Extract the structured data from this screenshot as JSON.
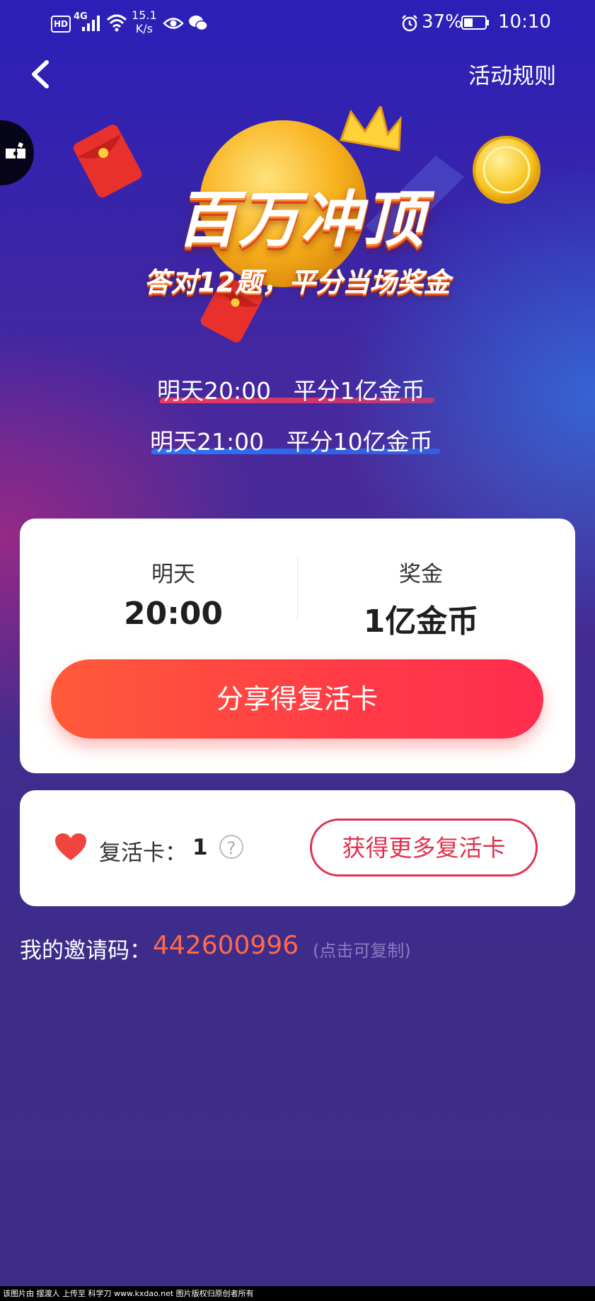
{
  "status_bar": {
    "hd": "HD",
    "network": "4G",
    "speed_value": "15.1",
    "speed_unit": "K/s",
    "battery": "37%",
    "time": "10:10"
  },
  "header": {
    "rules_label": "活动规则"
  },
  "hero": {
    "title": "百万冲顶",
    "subtitle": "答对12题，平分当场奖金"
  },
  "schedule": [
    {
      "time": "明天20:00",
      "prize": "平分1亿金币"
    },
    {
      "time": "明天21:00",
      "prize": "平分10亿金币"
    }
  ],
  "next_game": {
    "day_label": "明天",
    "time": "20:00",
    "prize_label": "奖金",
    "prize_value": "1亿金币",
    "share_button": "分享得复活卡"
  },
  "revive": {
    "label": "复活卡：",
    "count": "1",
    "help_symbol": "?",
    "more_button": "获得更多复活卡"
  },
  "invite": {
    "label": "我的邀请码：",
    "code": "442600996",
    "hint": "(点击可复制)"
  },
  "footer": {
    "text": "该图片由 摆渡人 上传至 科学刀 www.kxdao.net 图片版权归原创者所有"
  },
  "colors": {
    "accent": "#ff3b46",
    "invite_code": "#ff6b4a",
    "outline_button": "#e0324d"
  }
}
